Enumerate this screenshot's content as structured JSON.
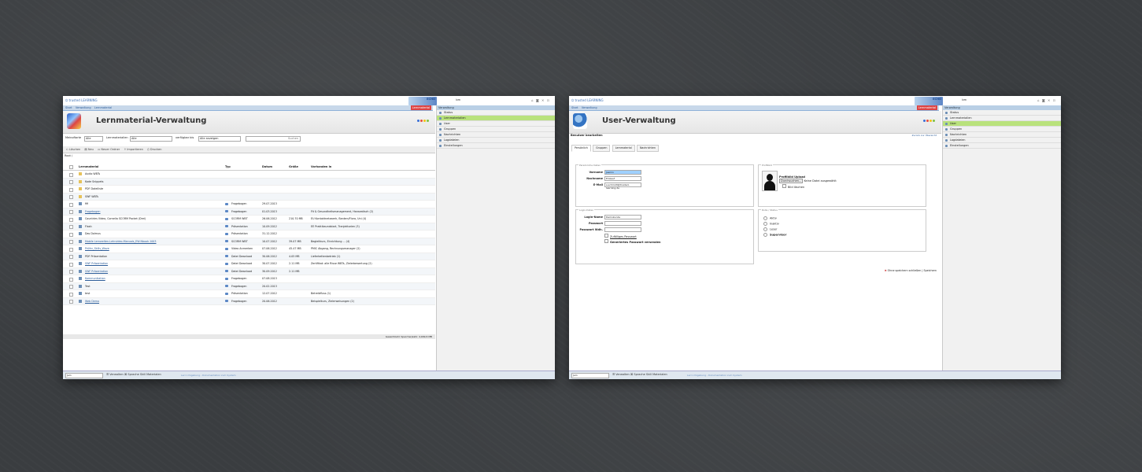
{
  "app": {
    "logo_text": "trusted LEARNING",
    "brand_text": "ECHO",
    "user_text": "bm",
    "window_icons": "⌂ ◙ ✕ ⊡",
    "nav_tabs": [
      "Start",
      "Verwaltung",
      "Lernmaterial"
    ],
    "accent_tab": "Lernmaterial"
  },
  "sidebar_left": {
    "header": "Verwaltung",
    "items": [
      "Status",
      "Lernmaterialien",
      "User",
      "Gruppen",
      "Nachrichten",
      "Logdateien",
      "Einstellungen"
    ],
    "active": 1
  },
  "sidebar_right": {
    "header": "Verwaltung",
    "items": [
      "Status",
      "Lernmaterialien",
      "User",
      "Gruppen",
      "Nachrichten",
      "Logdateien",
      "Einstellungen"
    ],
    "active": 2
  },
  "bottombar": {
    "select_value": "Jam",
    "links": "☰ Verwalten  ⌘ Sprache  Skill  Materialen",
    "hint": "Lern Umgebung - Dokumentation zum System"
  },
  "lernmaterial": {
    "title": "Lernmaterial-Verwaltung",
    "dots": [
      "#3a6ed6",
      "#e84c3d",
      "#f1c40f",
      "#7dc242"
    ],
    "filters": {
      "label1": "Meinoftarte",
      "value1": "Alle",
      "label2": "Lernmaterialien",
      "value2": "Alle",
      "label3": "verfügbar bis",
      "value3": "Alle anzeigen",
      "search_button": "Suchen"
    },
    "toolbar": [
      "⎌ Löschen",
      "▤ Neu",
      "▭ Neuer Ordner",
      "⇪ Importieren",
      "⎙ Drucken"
    ],
    "crumb": "Root /",
    "columns": [
      "Lernmaterial",
      "Typ",
      "Datum",
      "Größe",
      "Vorhanden in"
    ],
    "rows": [
      {
        "name": "Audio WBTs",
        "type": "",
        "date": "",
        "size": "",
        "in": "",
        "folder": true,
        "link": false
      },
      {
        "name": "Kode Snippets",
        "type": "",
        "date": "",
        "size": "",
        "in": "",
        "folder": true,
        "link": false
      },
      {
        "name": "PDF Dateiliste",
        "type": "",
        "date": "",
        "size": "",
        "in": "",
        "folder": true,
        "link": false
      },
      {
        "name": "SWF WBTs",
        "type": "",
        "date": "",
        "size": "",
        "in": "",
        "folder": true,
        "link": false
      },
      {
        "name": "fifi",
        "type": "Fragebogen",
        "date": "29.07.2013",
        "size": "",
        "in": "",
        "folder": false,
        "link": false
      },
      {
        "name": "Fragebogen",
        "type": "Fragebogen",
        "date": "01.03.2013",
        "size": "",
        "in": "Fit & Gesundheitsmanagement, Hanseatisch (2)",
        "folder": false,
        "link": true
      },
      {
        "name": "Countries Video, Cornelia SCORM Packet (Drei)",
        "type": "SCORM WBT",
        "date": "26.06.2012",
        "size": "210.70 MB",
        "in": "EU Kontaktnetzwerk, Banken/Flora, Uni (4)",
        "folder": false,
        "link": false
      },
      {
        "name": "Flash",
        "type": "Präsentation",
        "date": "10.09.2012",
        "size": "",
        "in": "EE Praktikaundstart, Tranjektorien (3)",
        "folder": false,
        "link": false
      },
      {
        "name": "Das Dolmus",
        "type": "Präsentation",
        "date": "31.12.2012",
        "size": "",
        "in": "",
        "folder": false,
        "link": false
      },
      {
        "name": "Mobile Lernwelten-Lehrvideo-Manuals_EW-Nbook.1003",
        "type": "SCORM WBT",
        "date": "10.07.2012",
        "size": "39.07 MB",
        "in": "Begleitkurs, Einrichtung ... (4)",
        "folder": false,
        "link": true
      },
      {
        "name": "Prüfer_Skills_Wave",
        "type": "Video Anmerken",
        "date": "07.06.2012",
        "size": "45.47 MB",
        "in": "PMIC Abgang, Rechnungsmanager (2)",
        "folder": false,
        "link": true
      },
      {
        "name": "PDF Präsentation",
        "type": "Datei Download",
        "date": "30.06.2012",
        "size": "4.05 MB",
        "in": "Lieferkettenbetrieb (1)",
        "folder": false,
        "link": false
      },
      {
        "name": "SWF Präsentation",
        "type": "Datei Download",
        "date": "30.07.2012",
        "size": "2.11 MB",
        "in": "Zertifikat: alle Risse WBTs, Zielerbewertung (2)",
        "folder": false,
        "link": true
      },
      {
        "name": "SWF Präsentation",
        "type": "Datei Download",
        "date": "30.09.2012",
        "size": "2.11 MB",
        "in": "",
        "folder": false,
        "link": true
      },
      {
        "name": "Kommunikation",
        "type": "Fragebogen",
        "date": "07.08.2013",
        "size": "",
        "in": "",
        "folder": false,
        "link": true
      },
      {
        "name": "Test",
        "type": "Fragebogen",
        "date": "20.02.2013",
        "size": "",
        "in": "",
        "folder": false,
        "link": false
      },
      {
        "name": "test",
        "type": "Präsentation",
        "date": "12.07.2012",
        "size": "",
        "in": "Betreibfluss (1)",
        "folder": false,
        "link": false
      },
      {
        "name": "Web Demo",
        "type": "Fragebogen",
        "date": "20.06.2012",
        "size": "",
        "in": "Beispielkurs, Zielerweisungen (2)",
        "folder": false,
        "link": true
      }
    ],
    "footer": "Gesamtzahl: Speicherplatz: 4,999,6 MB"
  },
  "user": {
    "title": "User-Verwaltung",
    "subhead": "Benutzer bearbeiten",
    "backlink": "Zurück zur Übersicht",
    "tabs": [
      "Persönlich",
      "Gruppen",
      "Lernmaterial",
      "Nachrichten"
    ],
    "personal_legend": "Persönliche Daten",
    "firstname_label": "Vorname",
    "firstname": "Jasmin",
    "lastname_label": "Nachname",
    "lastname": "Einkauf",
    "email_label": "E-Mail",
    "email": "a.schmidt@trusted-learning.de",
    "photo_legend": "Profilbild",
    "photo_upload_label": "Profilbild Upload",
    "choose_button": "Durchsuchen...",
    "no_file": "Keine Datei ausgewählt",
    "delete_photo": "Bild löschen",
    "login_legend": "Login-Daten",
    "login_label": "Login-Name",
    "login": "Demokunde",
    "password_label": "Passwort",
    "password_repeat_label": "Passwort Wdh.",
    "random_label": "Zufälliges Passwort",
    "send_label": "Generiertes Passwort versenden",
    "role_legend": "Rolle / Status",
    "roles": [
      "Aktiv",
      "Inaktiv",
      "Leser",
      "Supervisor"
    ],
    "cancel": "Ohne speichern schließen",
    "save": "Speichern"
  }
}
